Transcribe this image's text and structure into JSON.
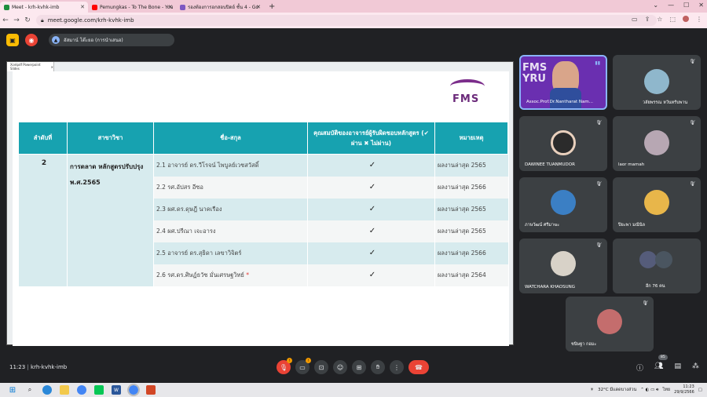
{
  "browser": {
    "tabs": [
      {
        "label": "Meet - krh-kvhk-imb",
        "color": "#1e8e3e"
      },
      {
        "label": "Pemungkas - To The Bone - You",
        "color": "#ff0000"
      },
      {
        "label": "รองท้องการอกสอบปิดย์ ชั้น 4 - Go",
        "color": "#7e57c2"
      }
    ],
    "new_tab": "+",
    "url": "meet.google.com/krh-kvhk-imb"
  },
  "meet": {
    "presenter_label": "อัสมาน์ โต๊ะยอ (การนำเสนอ)",
    "pres_tab_label": "Xcelpdf Powerpoint Slides"
  },
  "slide": {
    "logo_text": "FMS",
    "headers": {
      "no": "ลำดับที่",
      "major": "สาขาวิชา",
      "name": "ชื่อ-สกุล",
      "qual": "คุณสมบัติของอาจารย์ผู้รับผิดชอบหลักสูตร (✔ ผ่าน ✖ ไม่ผ่าน)",
      "note": "หมายเหตุ"
    },
    "row_no": "2",
    "major_text": "การตลาด หลักสูตรปรับปรุง พ.ศ.2565",
    "rows": [
      {
        "name": "2.1 อาจารย์ ดร.วีโรจน์ ไพบูลย์เวชสวัสดิ์",
        "check": "✓",
        "note": "ผลงานล่าสุด 2565"
      },
      {
        "name": "2.2 รศ.อัปสร อีซอ",
        "check": "✓",
        "note": "ผลงานล่าสุด 2566"
      },
      {
        "name": "2.3 ผศ.ดร.ดุษฎี นาคเรือง",
        "check": "✓",
        "note": "ผลงานล่าสุด 2565"
      },
      {
        "name": "2.4 ผศ.ปรีณา เจะอารง",
        "check": "✓",
        "note": "ผลงานล่าสุด 2565"
      },
      {
        "name": "2.5 อาจารย์ ดร.สุธิดา เลขาวิจิตร์",
        "check": "✓",
        "note": "ผลงานล่าสุด 2566"
      },
      {
        "name": "2.6 รศ.ดร.ศิษฏ์ธวัช มั่นเศรษฐวิทย์",
        "star": "*",
        "check": "✓",
        "note": "ผลงานล่าสุด 2564"
      }
    ]
  },
  "participants": [
    {
      "name": "Assoc.Prof.Dr.Nantharat Nam...",
      "speaking": true
    },
    {
      "name": "วลัยพรรณ หวันหรับพาน"
    },
    {
      "name": "DAWINEE TUANMUDOR"
    },
    {
      "name": "laor mamah"
    },
    {
      "name": "ภาษวัฒน์ ศรีมาฆะ"
    },
    {
      "name": "ปิยะพา มณีนิล"
    },
    {
      "name": "WATCHARA KHAOSUNG"
    },
    {
      "name": "อีก 76 คน"
    },
    {
      "name": "ชนิษฐา กอมะ"
    }
  ],
  "bottom": {
    "time": "11:23",
    "meeting_code": "krh-kvhk-imb",
    "participant_count": "85"
  },
  "taskbar": {
    "weather": "32°C มีแดดบางส่วน",
    "lang": "ไทย",
    "clock_time": "11:23",
    "clock_date": "29/9/2566"
  }
}
